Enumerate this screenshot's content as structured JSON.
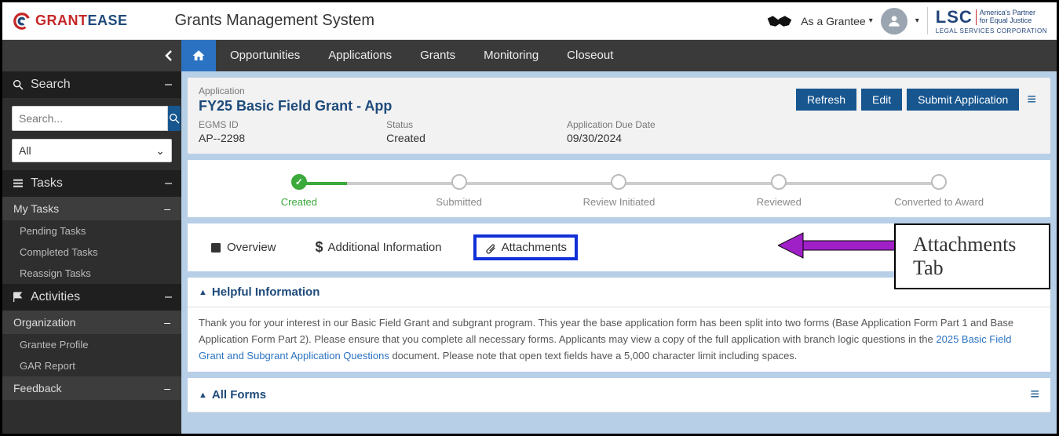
{
  "header": {
    "logo_text_1": "GRANT",
    "logo_text_2": "EASE",
    "app_title": "Grants Management System",
    "role_label": "As a Grantee",
    "lsc_main": "LSC",
    "lsc_line1": "America's Partner",
    "lsc_line2": "for Equal Justice",
    "lsc_tag": "LEGAL SERVICES CORPORATION"
  },
  "nav": {
    "items": [
      "Opportunities",
      "Applications",
      "Grants",
      "Monitoring",
      "Closeout"
    ]
  },
  "sidebar": {
    "search_label": "Search",
    "search_placeholder": "Search...",
    "filter_value": "All",
    "tasks_label": "Tasks",
    "my_tasks": "My Tasks",
    "task_items": [
      "Pending Tasks",
      "Completed Tasks",
      "Reassign Tasks"
    ],
    "activities_label": "Activities",
    "organization": "Organization",
    "org_items": [
      "Grantee Profile",
      "GAR Report"
    ],
    "feedback": "Feedback"
  },
  "app": {
    "crumb": "Application",
    "title": "FY25 Basic Field Grant - App",
    "btn_refresh": "Refresh",
    "btn_edit": "Edit",
    "btn_submit": "Submit Application",
    "meta": {
      "id_label": "EGMS ID",
      "id_value": "AP--2298",
      "status_label": "Status",
      "status_value": "Created",
      "due_label": "Application Due Date",
      "due_value": "09/30/2024"
    },
    "steps": [
      "Created",
      "Submitted",
      "Review Initiated",
      "Reviewed",
      "Converted to Award"
    ],
    "tabs": {
      "overview": "Overview",
      "additional": "Additional Information",
      "attachments": "Attachments"
    },
    "callout": "Attachments Tab",
    "helpful_hd": "Helpful Information",
    "helpful_body_1": "Thank you for your interest in our Basic Field Grant and subgrant program. This year the base application form has been split into two forms (Base Application Form Part 1 and Base Application Form Part 2). Please ensure that you complete all necessary forms. Applicants may view a copy of the full application with branch logic questions in the ",
    "helpful_link": "2025 Basic Field Grant and Subgrant Application Questions",
    "helpful_body_2": " document. Please note that open text fields have a 5,000 character limit including spaces.",
    "all_forms_hd": "All Forms"
  }
}
